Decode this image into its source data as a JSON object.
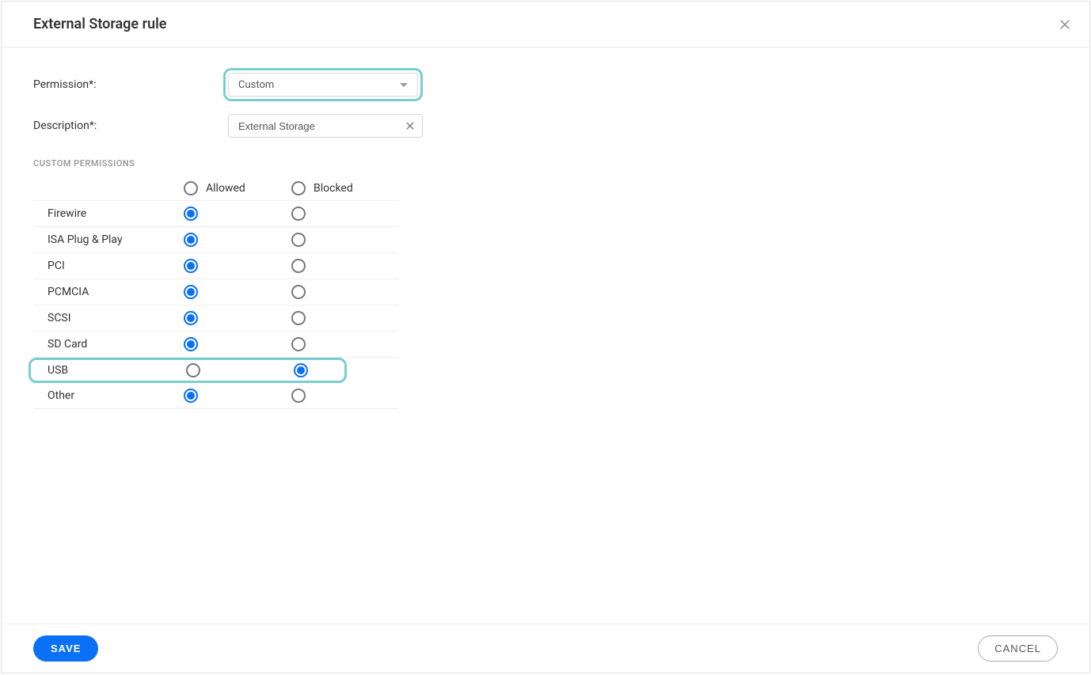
{
  "header": {
    "title": "External Storage rule"
  },
  "form": {
    "permission_label": "Permission*:",
    "permission_value": "Custom",
    "description_label": "Description*:",
    "description_value": "External Storage"
  },
  "custom_permissions": {
    "section_title": "CUSTOM PERMISSIONS",
    "col_allowed": "Allowed",
    "col_blocked": "Blocked",
    "rows": [
      {
        "label": "Firewire",
        "state": "allowed",
        "highlight": false
      },
      {
        "label": "ISA Plug & Play",
        "state": "allowed",
        "highlight": false
      },
      {
        "label": "PCI",
        "state": "allowed",
        "highlight": false
      },
      {
        "label": "PCMCIA",
        "state": "allowed",
        "highlight": false
      },
      {
        "label": "SCSI",
        "state": "allowed",
        "highlight": false
      },
      {
        "label": "SD Card",
        "state": "allowed",
        "highlight": false
      },
      {
        "label": "USB",
        "state": "blocked",
        "highlight": true
      },
      {
        "label": "Other",
        "state": "allowed",
        "highlight": false
      }
    ]
  },
  "footer": {
    "save_label": "SAVE",
    "cancel_label": "CANCEL"
  }
}
